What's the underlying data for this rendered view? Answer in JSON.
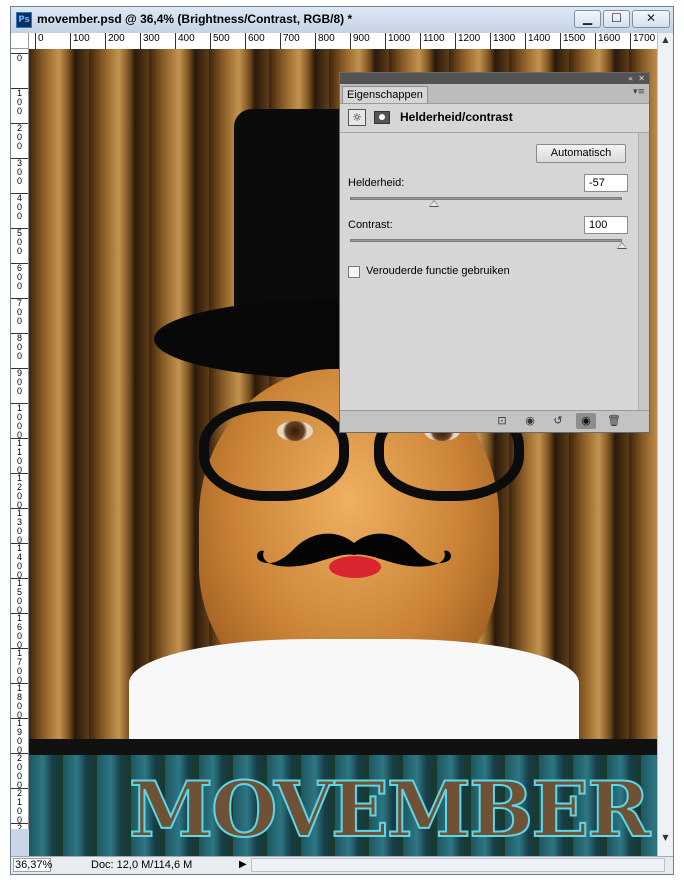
{
  "window": {
    "app_icon": "Ps",
    "title": "movember.psd @ 36,4% (Brightness/Contrast, RGB/8) *",
    "buttons": {
      "minimize": "▁",
      "maximize": "☐",
      "close": "✕"
    }
  },
  "ruler": {
    "top_ticks": [
      "0",
      "100",
      "200",
      "300",
      "400",
      "500",
      "600",
      "700",
      "800",
      "900",
      "1000",
      "1100",
      "1200",
      "1300",
      "1400",
      "1500",
      "1600",
      "1700"
    ],
    "left_ticks": [
      "0",
      "100",
      "200",
      "300",
      "400",
      "500",
      "600",
      "700",
      "800",
      "900",
      "1000",
      "1100",
      "1200",
      "1300",
      "1400",
      "1500",
      "1600",
      "1700",
      "1800",
      "1900",
      "2000",
      "2100",
      "2200"
    ]
  },
  "canvas": {
    "banner_text": "MOVEMBER"
  },
  "properties_panel": {
    "collapse_glyph": "«",
    "close_glyph": "✕",
    "tab_label": "Eigenschappen",
    "menu_icon": "▾≡",
    "adjustment_icon": "☼",
    "adjustment_title": "Helderheid/contrast",
    "auto_button": "Automatisch",
    "brightness": {
      "label": "Helderheid:",
      "value": "-57",
      "slider_fraction": 0.31
    },
    "contrast": {
      "label": "Contrast:",
      "value": "100",
      "slider_fraction": 1.0
    },
    "legacy_checkbox": {
      "label": "Verouderde functie gebruiken",
      "checked": false
    },
    "bottom_icons": [
      "clip-to-layer-icon",
      "view-previous-icon",
      "reset-icon",
      "visibility-eye-icon",
      "trash-icon"
    ]
  },
  "status_bar": {
    "zoom": "36,37%",
    "doc_info": "Doc: 12,0 M/114,6 M",
    "arrow": "▶"
  }
}
